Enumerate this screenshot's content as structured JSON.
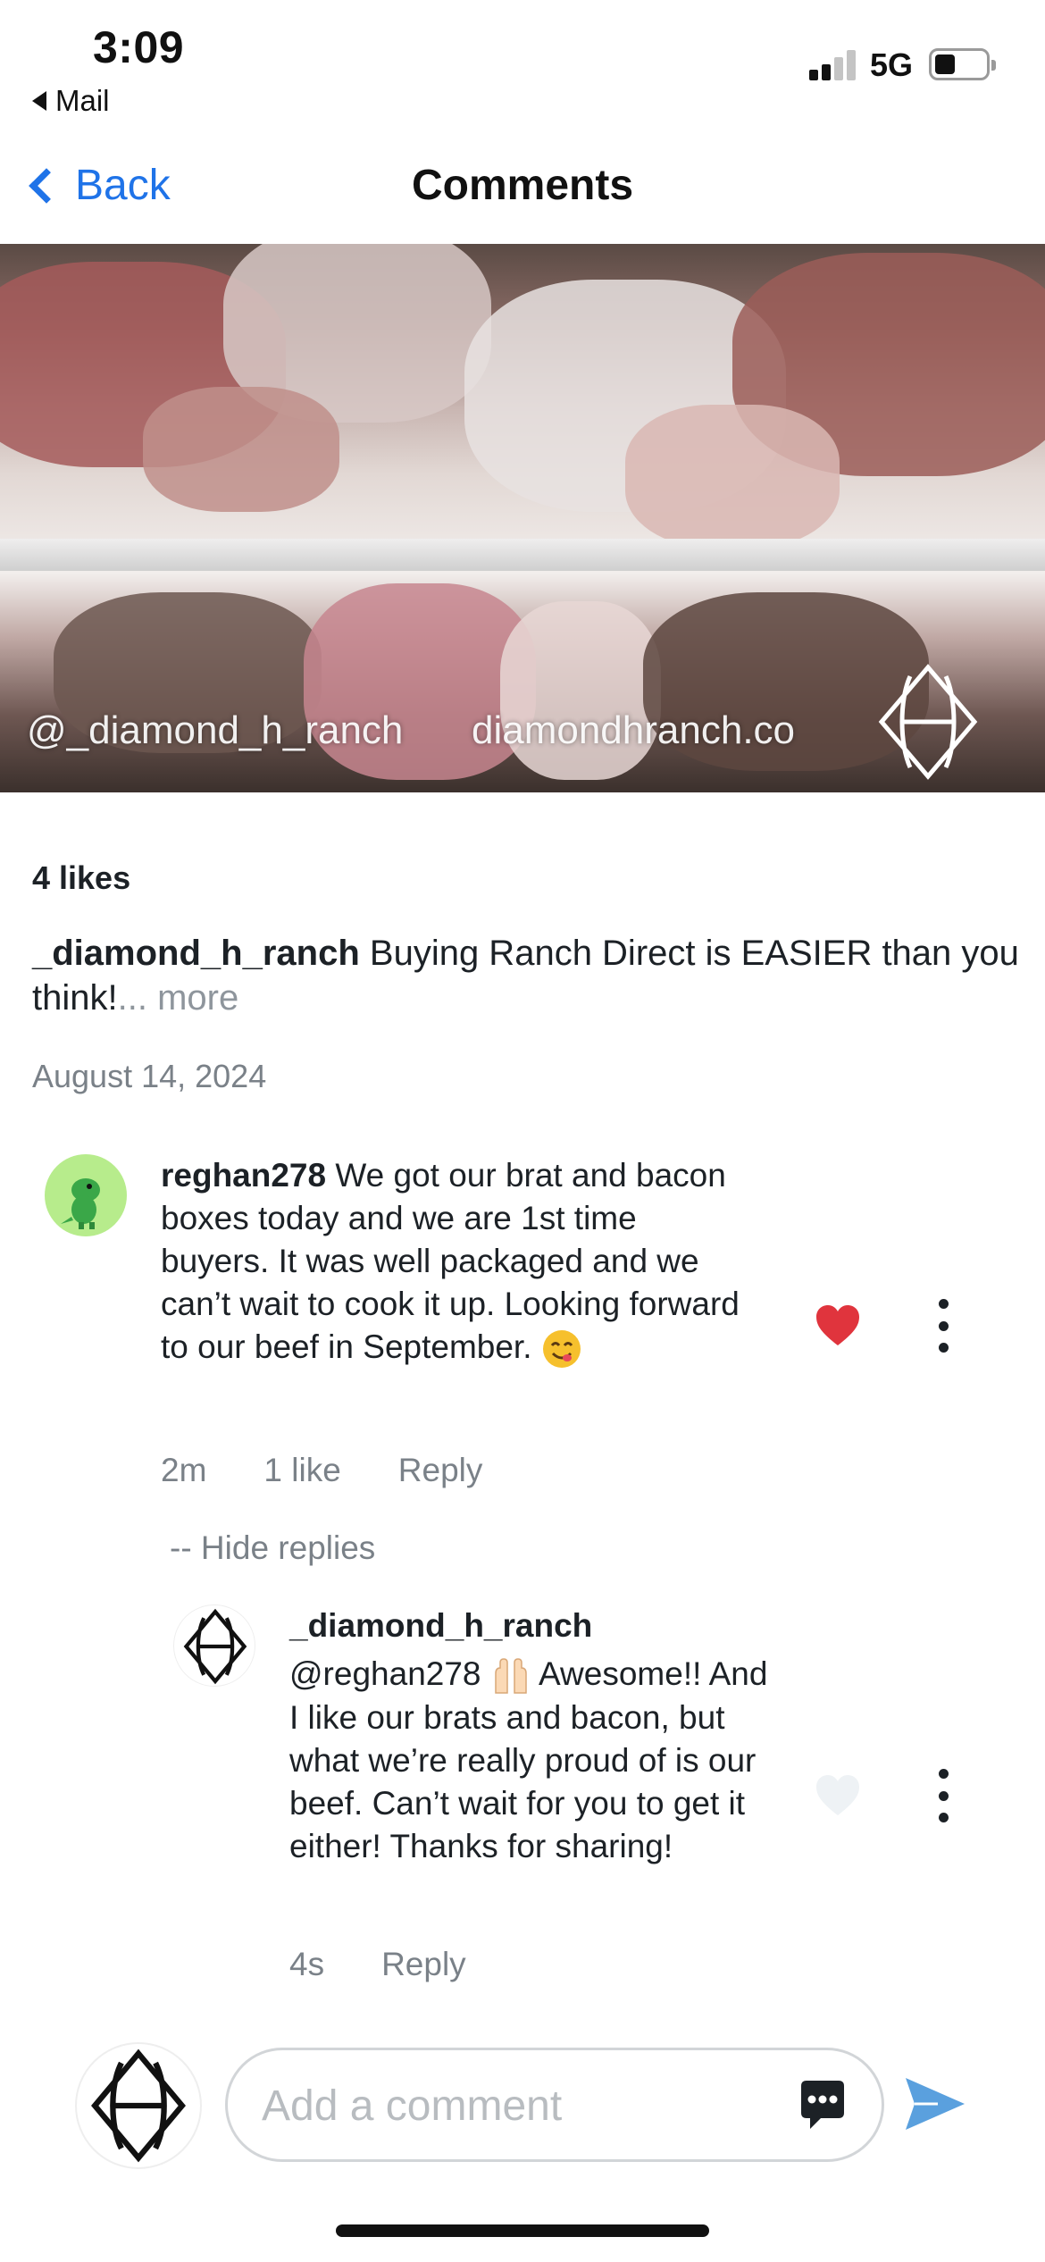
{
  "status_bar": {
    "time": "3:09",
    "back_app": "Mail",
    "network": "5G"
  },
  "nav": {
    "back_label": "Back",
    "title": "Comments"
  },
  "banner": {
    "watermark_handle": "@_diamond_h_ranch",
    "watermark_site": "diamondhranch.co"
  },
  "post": {
    "likes": "4 likes",
    "caption_user": "_diamond_h_ranch",
    "caption_text": "Buying Ranch Direct is EASIER than you think!",
    "caption_more": "... more",
    "date": "August 14, 2024"
  },
  "comment": {
    "user": "reghan278",
    "text": "We got our brat and bacon boxes today and we are 1st time buyers. It was well packaged and we can’t wait to cook it up. Looking forward to our beef in September.",
    "time": "2m",
    "likes": "1 like",
    "reply_label": "Reply",
    "liked": true
  },
  "hide_replies": "-- Hide replies",
  "reply": {
    "user": "_diamond_h_ranch",
    "mention": "@reghan278",
    "text_after_emoji": "Awesome!! And I like our brats and bacon, but what we’re really proud of is our beef. Can’t wait for you to get it either! Thanks for sharing!",
    "time": "4s",
    "reply_label": "Reply",
    "liked": false
  },
  "composer": {
    "placeholder": "Add a comment"
  },
  "colors": {
    "accent_blue": "#1f73e8",
    "heart_red": "#e0343d",
    "muted_text": "#7a8188",
    "send_blue": "#5aa0de"
  },
  "icons": [
    "chevron-left-icon",
    "heart-icon",
    "more-vertical-icon",
    "chat-bubble-icon",
    "send-icon",
    "diamond-h-logo-icon",
    "dinosaur-avatar-icon",
    "yum-emoji-icon",
    "raising-hands-emoji-icon"
  ]
}
